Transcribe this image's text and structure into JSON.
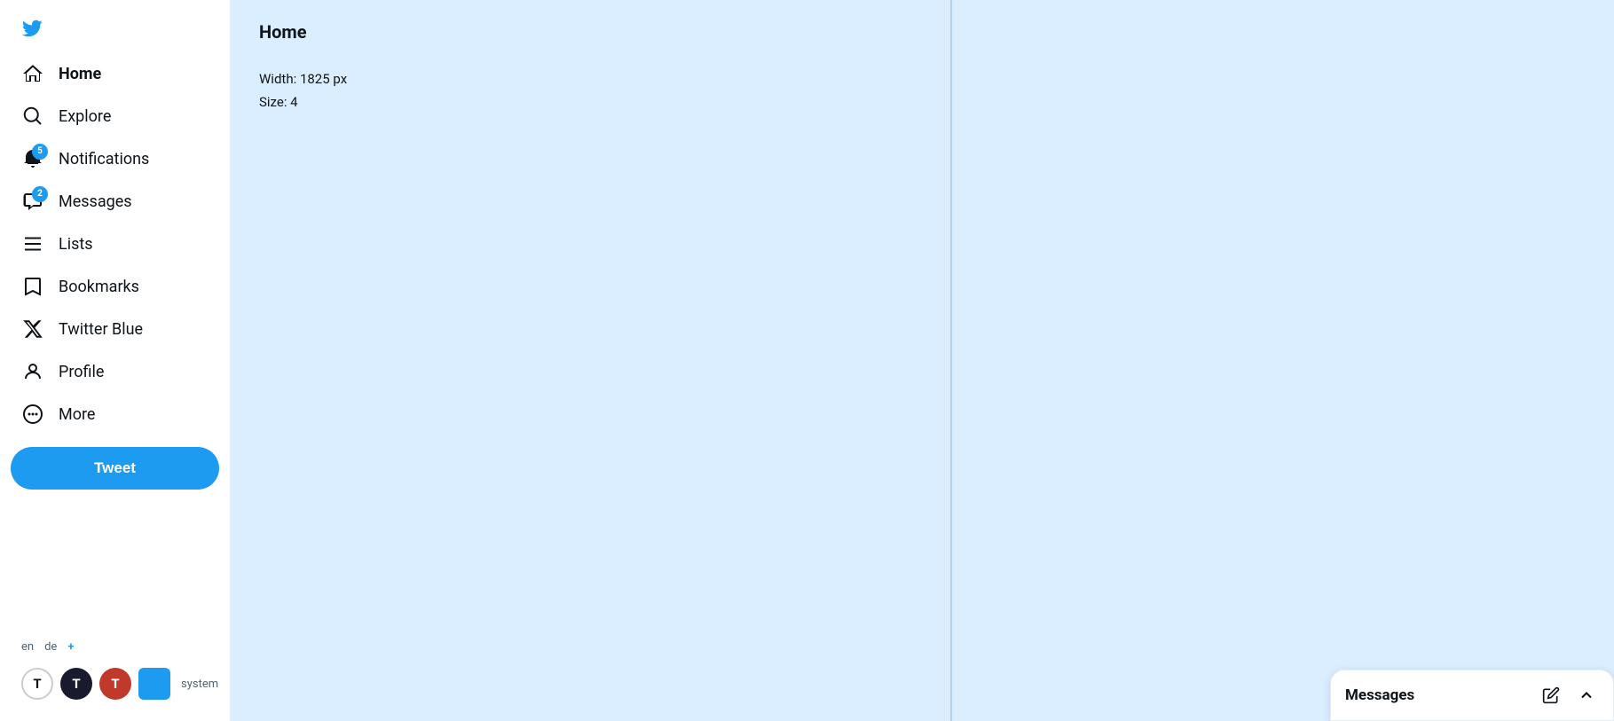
{
  "sidebar": {
    "logo_label": "Twitter",
    "nav_items": [
      {
        "id": "home",
        "label": "Home",
        "icon": "home",
        "active": true,
        "badge": null
      },
      {
        "id": "explore",
        "label": "Explore",
        "icon": "explore",
        "active": false,
        "badge": null
      },
      {
        "id": "notifications",
        "label": "Notifications",
        "icon": "notifications",
        "active": false,
        "badge": "5"
      },
      {
        "id": "messages",
        "label": "Messages",
        "icon": "messages",
        "active": false,
        "badge": "2"
      },
      {
        "id": "lists",
        "label": "Lists",
        "icon": "lists",
        "active": false,
        "badge": null
      },
      {
        "id": "bookmarks",
        "label": "Bookmarks",
        "icon": "bookmarks",
        "active": false,
        "badge": null
      },
      {
        "id": "twitter-blue",
        "label": "Twitter Blue",
        "icon": "twitter-blue",
        "active": false,
        "badge": null
      },
      {
        "id": "profile",
        "label": "Profile",
        "icon": "profile",
        "active": false,
        "badge": null
      },
      {
        "id": "more",
        "label": "More",
        "icon": "more",
        "active": false,
        "badge": null
      }
    ],
    "tweet_button_label": "Tweet",
    "lang_options": [
      "en",
      "de"
    ],
    "lang_plus": "+",
    "accounts": [
      {
        "id": "t-outline",
        "letter": "T",
        "type": "outline"
      },
      {
        "id": "t-dark",
        "letter": "T",
        "bg": "#1a1a2e",
        "type": "filled"
      },
      {
        "id": "t-red",
        "letter": "T",
        "bg": "#c0392b",
        "type": "filled"
      },
      {
        "id": "system",
        "label": "system",
        "type": "system"
      }
    ]
  },
  "main": {
    "title": "Home",
    "width_label": "Width: 1825 px",
    "size_label": "Size: 4"
  },
  "messages_popup": {
    "title": "Messages",
    "compose_icon": "compose",
    "collapse_icon": "chevron-up"
  }
}
